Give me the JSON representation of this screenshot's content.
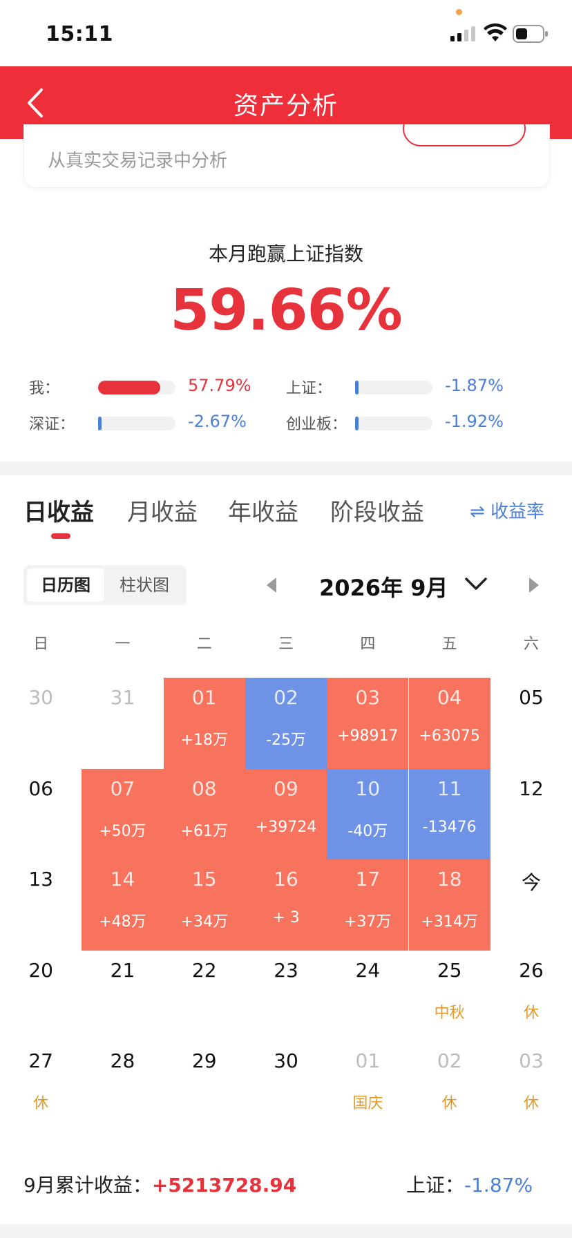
{
  "status_bar": {
    "time": "15:11"
  },
  "header": {
    "title": "资产分析"
  },
  "card": {
    "subtitle": "从真实交易记录中分析"
  },
  "beat": {
    "label": "本月跑赢上证指数",
    "percent": "59.66%"
  },
  "comparisons": [
    {
      "label": "我：",
      "value": "57.79%",
      "fill_fraction": 1.0,
      "color": "#e5323b",
      "value_color": "#e5323b"
    },
    {
      "label": "上证：",
      "value": "-1.87%",
      "fill_fraction": 0.03,
      "color": "#4a7fd6",
      "value_color": "#4a7fd6"
    },
    {
      "label": "深证：",
      "value": "-2.67%",
      "fill_fraction": 0.05,
      "color": "#4a7fd6",
      "value_color": "#4a7fd6"
    },
    {
      "label": "创业板：",
      "value": "-1.92%",
      "fill_fraction": 0.03,
      "color": "#4a7fd6",
      "value_color": "#4a7fd6"
    }
  ],
  "tabs": [
    {
      "label": "日收益",
      "active": true
    },
    {
      "label": "月收益",
      "active": false
    },
    {
      "label": "年收益",
      "active": false
    },
    {
      "label": "阶段收益",
      "active": false
    }
  ],
  "rate_toggle": "⇌ 收益率",
  "view_toggle": {
    "calendar": "日历图",
    "bar": "柱状图",
    "selected": "日历图"
  },
  "month": {
    "label": "2026年 9月"
  },
  "weekdays": [
    "日",
    "一",
    "二",
    "三",
    "四",
    "五",
    "六"
  ],
  "calendar": [
    [
      {
        "d": "30",
        "muted": true
      },
      {
        "d": "31",
        "muted": true
      },
      {
        "d": "01",
        "s": "+18万",
        "t": "up"
      },
      {
        "d": "02",
        "s": "-25万",
        "t": "down"
      },
      {
        "d": "03",
        "s": "+98917",
        "t": "up"
      },
      {
        "d": "04",
        "s": "+63075",
        "t": "up"
      },
      {
        "d": "05"
      }
    ],
    [
      {
        "d": "06"
      },
      {
        "d": "07",
        "s": "+50万",
        "t": "up"
      },
      {
        "d": "08",
        "s": "+61万",
        "t": "up"
      },
      {
        "d": "09",
        "s": "+39724",
        "t": "up"
      },
      {
        "d": "10",
        "s": "-40万",
        "t": "down"
      },
      {
        "d": "11",
        "s": "-13476",
        "t": "down"
      },
      {
        "d": "12"
      }
    ],
    [
      {
        "d": "13"
      },
      {
        "d": "14",
        "s": "+48万",
        "t": "up"
      },
      {
        "d": "15",
        "s": "+34万",
        "t": "up"
      },
      {
        "d": "16",
        "s": "+ 3",
        "t": "up"
      },
      {
        "d": "17",
        "s": "+37万",
        "t": "up"
      },
      {
        "d": "18",
        "s": "+314万",
        "t": "up"
      },
      {
        "d": "今"
      }
    ],
    [
      {
        "d": "20"
      },
      {
        "d": "21"
      },
      {
        "d": "22"
      },
      {
        "d": "23"
      },
      {
        "d": "24"
      },
      {
        "d": "25",
        "s": "中秋",
        "hol": true
      },
      {
        "d": "26",
        "s": "休",
        "hol": true
      }
    ],
    [
      {
        "d": "27",
        "s": "休",
        "hol": true
      },
      {
        "d": "28"
      },
      {
        "d": "29"
      },
      {
        "d": "30"
      },
      {
        "d": "01",
        "s": "国庆",
        "hol": true,
        "muted": true
      },
      {
        "d": "02",
        "s": "休",
        "hol": true,
        "muted": true
      },
      {
        "d": "03",
        "s": "休",
        "hol": true,
        "muted": true
      }
    ]
  ],
  "summary": {
    "label": "9月累计收益：",
    "value": "+5213728.94",
    "index_label": "上证：",
    "index_value": "-1.87%"
  },
  "colors": {
    "brand_red": "#ee2f3a",
    "gain": "#f7735d",
    "loss": "#6e93e6",
    "holiday": "#e29a2a"
  }
}
